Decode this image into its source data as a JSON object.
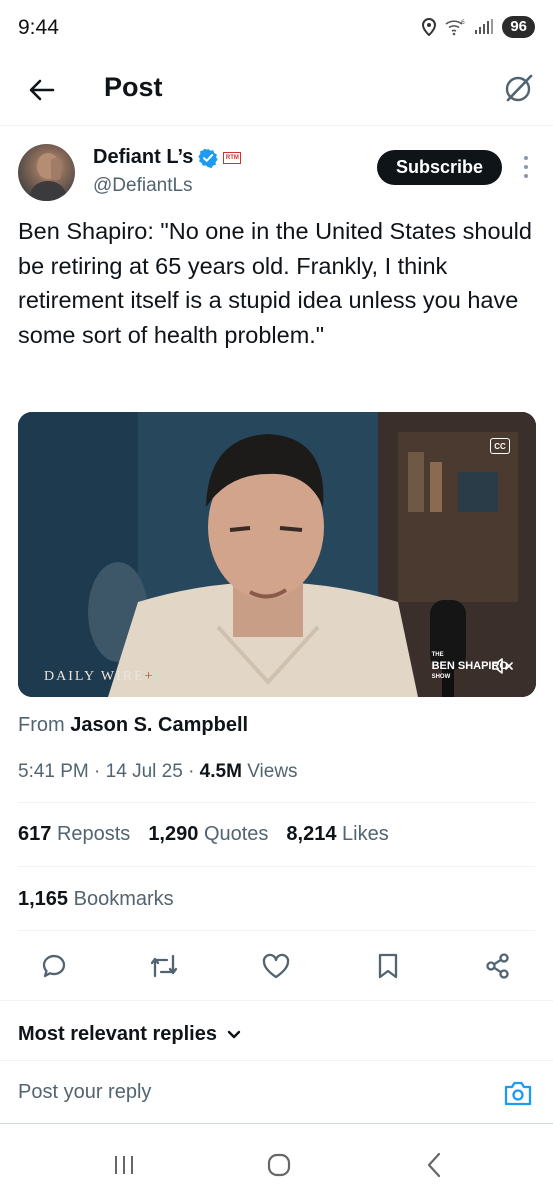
{
  "status_bar": {
    "time": "9:44",
    "battery": "96",
    "network": "6"
  },
  "header": {
    "title": "Post"
  },
  "author": {
    "display_name": "Defiant L’s",
    "handle": "@DefiantLs",
    "subscribe_label": "Subscribe",
    "affiliate_badge": "RTM"
  },
  "tweet": {
    "text": "Ben Shapiro: \"No one in the United States should be retiring at 65 years old. Frankly, I think retirement itself is a stupid idea unless you have some sort of health problem.\""
  },
  "media": {
    "cc_label": "CC",
    "watermark": "DAILY WIRE",
    "watermark_plus": "+",
    "show_logo_small": "THE",
    "show_logo": "BEN SHAPIRO",
    "show_logo_sub": "SHOW"
  },
  "source": {
    "prefix": "From",
    "name": "Jason S. Campbell"
  },
  "meta": {
    "time": "5:41 PM",
    "date": "14 Jul 25",
    "views_count": "4.5M",
    "views_label": "Views",
    "separator": "·"
  },
  "stats": {
    "reposts_count": "617",
    "reposts_label": "Reposts",
    "quotes_count": "1,290",
    "quotes_label": "Quotes",
    "likes_count": "8,214",
    "likes_label": "Likes",
    "bookmarks_count": "1,165",
    "bookmarks_label": "Bookmarks"
  },
  "actions": [
    "reply-icon",
    "repost-icon",
    "like-icon",
    "bookmark-icon",
    "share-icon"
  ],
  "replies": {
    "sort_label": "Most relevant replies"
  },
  "reply_bar": {
    "placeholder": "Post your reply"
  },
  "colors": {
    "accent": "#1d9bf0",
    "text": "#0f1419",
    "secondary": "#536471",
    "divider": "#eff3f4"
  }
}
